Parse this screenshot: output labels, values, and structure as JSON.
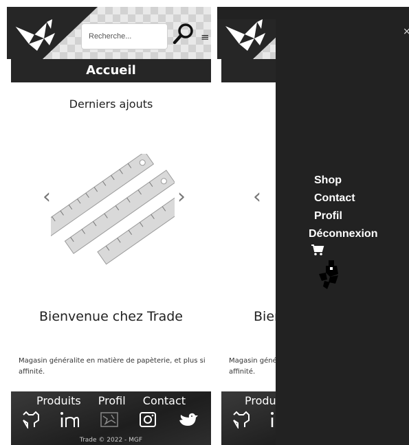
{
  "header": {
    "search_placeholder": "Recherche...",
    "search_icon": "magnifier-icon",
    "menu_icon": "hamburger-icon",
    "logo_icon": "origami-fox-logo"
  },
  "page": {
    "title": "Accueil",
    "section_title": "Derniers ajouts",
    "carousel_prev": "‹",
    "carousel_next": "›",
    "slide_image": "rulers-product-image",
    "welcome": "Bienvenue chez Trade",
    "description": "Magasin généralite en matière de papèterie, et plus si affinité."
  },
  "footer": {
    "links": [
      "Produits",
      "Profil",
      "Contact"
    ],
    "social_icons": [
      "github-icon",
      "linkedin-icon",
      "map-icon",
      "instagram-icon",
      "bird-icon"
    ],
    "copyright": "Trade © 2022 - MGF"
  },
  "right_panel": {
    "partial_texts": {
      "welcome": "Bier",
      "description": "Magasin géné\naffinité.",
      "footer_link": "Produ"
    },
    "close": "×",
    "nav": [
      "Shop",
      "Contact",
      "Profil",
      "Déconnexion"
    ],
    "cart_icon": "cart-icon",
    "mascot_icon": "pixel-mascot-icon"
  },
  "colors": {
    "dark": "#262626",
    "overlay": "#222222",
    "text": "#212121"
  }
}
